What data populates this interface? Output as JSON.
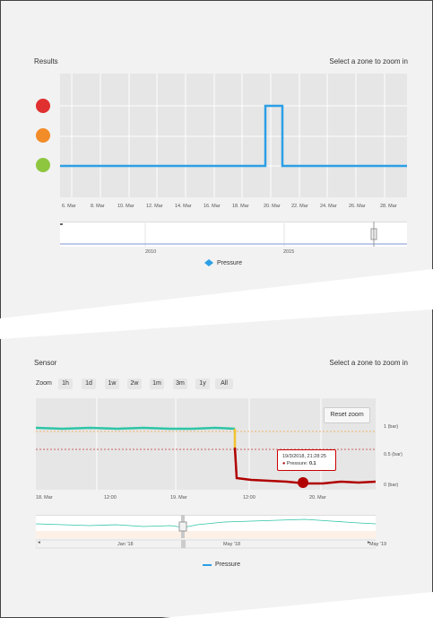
{
  "results": {
    "title": "Results",
    "hint": "Select a zone to zoom in",
    "status_colors": [
      "#e03030",
      "#f28c28",
      "#8ec63f"
    ],
    "x_ticks": [
      "6. Mar",
      "8. Mar",
      "10. Mar",
      "12. Mar",
      "14. Mar",
      "16. Mar",
      "18. Mar",
      "20. Mar",
      "22. Mar",
      "24. Mar",
      "26. Mar",
      "28. Mar"
    ],
    "navigator_ticks": [
      "2010",
      "2015"
    ],
    "legend": "Pressure",
    "legend_icon": "diamond-icon",
    "line_color": "#2b9fe6",
    "series_levels": {
      "dates": [
        "4. Mar",
        "6. Mar",
        "8. Mar",
        "10. Mar",
        "12. Mar",
        "14. Mar",
        "16. Mar",
        "18. Mar",
        "19. Mar",
        "19.5 Mar",
        "20.5 Mar",
        "21 Mar",
        "22. Mar",
        "24. Mar",
        "26. Mar",
        "28. Mar",
        "29. Mar"
      ],
      "levels": [
        "green",
        "green",
        "green",
        "green",
        "green",
        "green",
        "green",
        "green",
        "green",
        "red",
        "red",
        "green",
        "green",
        "green",
        "green",
        "green",
        "green"
      ]
    }
  },
  "sensor": {
    "title": "Sensor",
    "hint": "Select a zone to zoom in",
    "zoom_label": "Zoom",
    "zoom_buttons": [
      "1h",
      "1d",
      "1w",
      "2w",
      "1m",
      "3m",
      "1y",
      "All"
    ],
    "reset_zoom": "Reset zoom",
    "y_ticks": [
      "1 (bar)",
      "0.5 (bar)",
      "0 (bar)"
    ],
    "x_ticks": [
      "18. Mar",
      "12:00",
      "19. Mar",
      "12:00",
      "20. Mar"
    ],
    "navigator_ticks": [
      "Jan '18",
      "May '18",
      "May '19"
    ],
    "tooltip_date": "19/3/2018, 21:28:25",
    "tooltip_series": "Pressure:",
    "tooltip_value": "0.1",
    "legend": "Pressure",
    "legend_icon": "line-icon",
    "line_colors": {
      "high": "#2ec4a6",
      "mid": "#f2c230",
      "low": "#b00000",
      "legend": "#2b9fe6"
    },
    "threshold_colors": {
      "upper": "#f0a040",
      "lower": "#c03030"
    }
  }
}
